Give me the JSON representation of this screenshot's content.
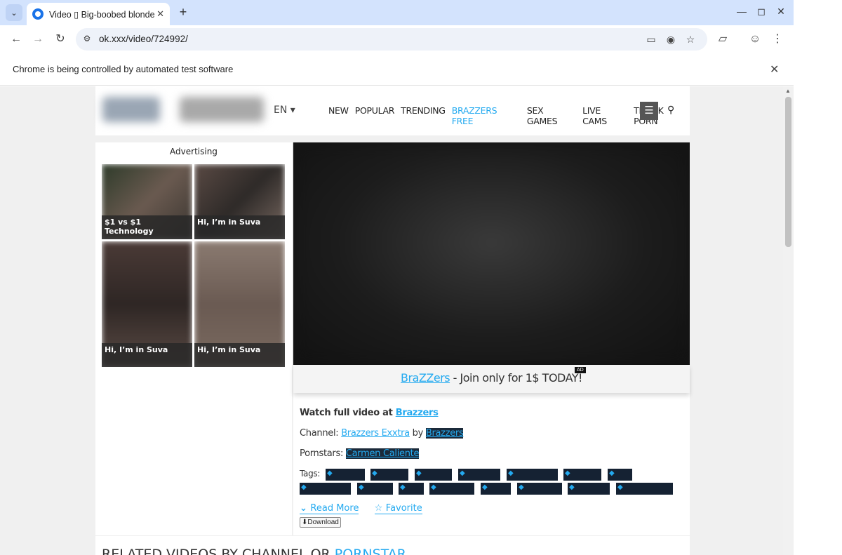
{
  "browser": {
    "tab_title": "Video ▯ Big-boobed blonde",
    "url": "ok.xxx/video/724992/",
    "infobar_text": "Chrome is being controlled by automated test software"
  },
  "header": {
    "lang": "EN ▾",
    "nav": [
      "NEW",
      "POPULAR",
      "TRENDING",
      "BRAZZERS FREE",
      "SEX GAMES",
      "LIVE CAMS",
      "TIKTOK PORN"
    ]
  },
  "ads": {
    "title": "Advertising",
    "items": [
      {
        "caption": "$1 vs $1 Technology"
      },
      {
        "caption": "Hi, I’m in Suva"
      },
      {
        "caption": "Hi, I’m in Suva"
      },
      {
        "caption": "Hi, I’m in Suva"
      }
    ]
  },
  "video": {
    "ad_brand": "BraZZers",
    "ad_text": " - Join only for 1$ TODAY!",
    "ad_badge": "AD",
    "watch_label": "Watch full video at ",
    "watch_link": "Brazzers",
    "channel_label": "Channel: ",
    "channel_link": "Brazzers Exxtra",
    "by_label": " by ",
    "network_link": "Brazzers",
    "pornstars_label": "Pornstars: ",
    "pornstar_link": "Carmen Caliente",
    "tags_label": "Tags:",
    "read_more": "Read More",
    "favorite": "Favorite",
    "download": "⬇Download"
  },
  "related": {
    "title": "RELATED VIDEOS BY CHANNEL OR ",
    "title_hl": "PORNSTAR"
  },
  "colors": {
    "accent": "#24aaf0",
    "tag_bg": "#152233"
  }
}
